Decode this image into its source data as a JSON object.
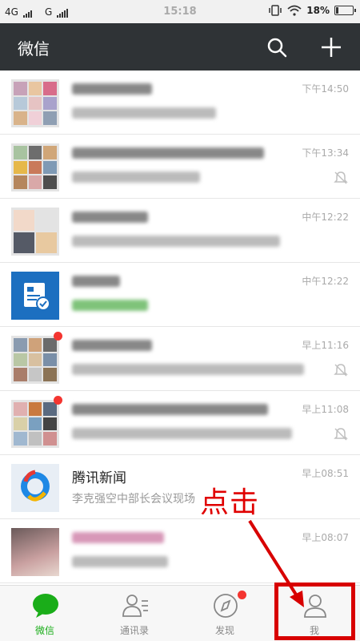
{
  "status_bar": {
    "network_left": "4G",
    "network_right": "G",
    "time": "15:18",
    "battery_pct": "18%",
    "battery_level": 0.18,
    "icons": [
      "vibrate-icon",
      "wifi-icon",
      "battery-icon"
    ]
  },
  "app_bar": {
    "title": "微信",
    "icons": [
      "search-icon",
      "plus-icon"
    ]
  },
  "chats": [
    {
      "name": "",
      "preview": "",
      "time": "下午14:50",
      "avatar": "group-grid",
      "badge": false,
      "muted": false
    },
    {
      "name": "",
      "preview": "",
      "time": "下午13:34",
      "avatar": "group-grid",
      "badge": false,
      "muted": true
    },
    {
      "name": "",
      "preview": "",
      "time": "中午12:22",
      "avatar": "group-grid",
      "badge": false,
      "muted": false
    },
    {
      "name": "",
      "preview": "",
      "time": "中午12:22",
      "avatar": "service-icon",
      "badge": false,
      "muted": false
    },
    {
      "name": "",
      "preview": "",
      "time": "早上11:16",
      "avatar": "group-grid",
      "badge": true,
      "muted": true
    },
    {
      "name": "",
      "preview": "",
      "time": "早上11:08",
      "avatar": "group-grid",
      "badge": true,
      "muted": true
    },
    {
      "name": "腾讯新闻",
      "preview": "李克强空中部长会议现场",
      "time": "早上08:51",
      "avatar": "tencent-news-logo",
      "badge": false,
      "muted": false
    },
    {
      "name": "",
      "preview": "",
      "time": "早上08:07",
      "avatar": "photo",
      "badge": false,
      "muted": false
    }
  ],
  "tabs": [
    {
      "label": "微信",
      "icon": "chat-bubble-icon",
      "active": true,
      "dot": false
    },
    {
      "label": "通讯录",
      "icon": "contacts-icon",
      "active": false,
      "dot": false
    },
    {
      "label": "发现",
      "icon": "compass-icon",
      "active": false,
      "dot": true
    },
    {
      "label": "我",
      "icon": "person-icon",
      "active": false,
      "dot": false
    }
  ],
  "annotation": {
    "text": "点击",
    "color": "#e00000"
  },
  "colors": {
    "app_bar_bg": "#2f3336",
    "accent_green": "#1aad19",
    "badge_red": "#f43530"
  }
}
